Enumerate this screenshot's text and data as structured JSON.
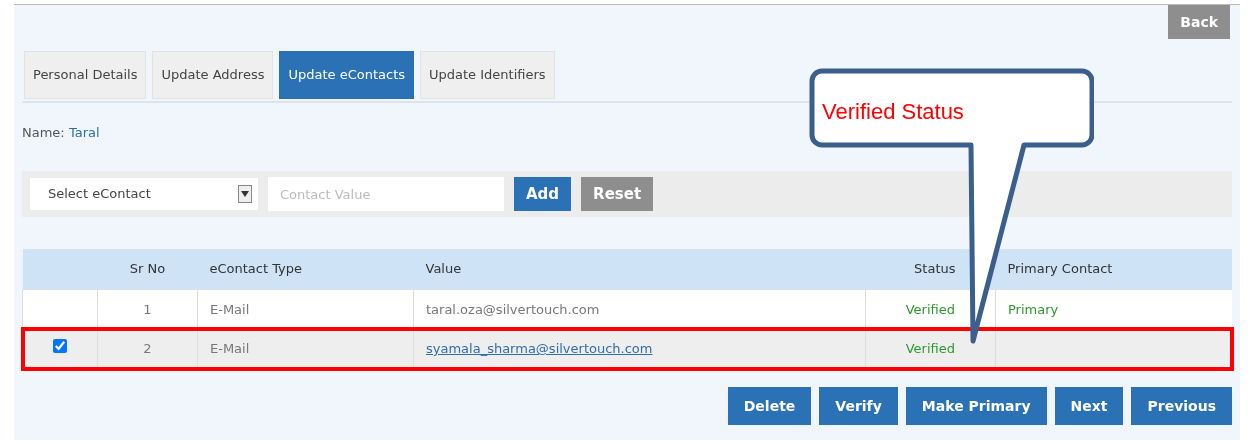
{
  "back_button": "Back",
  "tabs": [
    {
      "label": "Personal Details",
      "selected": false
    },
    {
      "label": "Update Address",
      "selected": false
    },
    {
      "label": "Update eContacts",
      "selected": true
    },
    {
      "label": "Update Identifiers",
      "selected": false
    }
  ],
  "name": {
    "label": "Name:",
    "value": "Taral"
  },
  "form": {
    "select": "Select eContact",
    "placeholder": "Contact Value",
    "buttons": [
      {
        "label": "Add",
        "kind": "primary"
      },
      {
        "label": "Reset",
        "kind": "secondary"
      }
    ]
  },
  "table": {
    "columns": [
      "Sr No",
      "eContact Type",
      "Value",
      "Status",
      "Primary Contact"
    ],
    "rows": [
      {
        "checked": false,
        "highlighted": false,
        "sr_no": "1",
        "type": "E-Mail",
        "value": "taral.oza@silvertouch.com",
        "link": false,
        "status": "Verified",
        "primary": "Primary"
      },
      {
        "checked": true,
        "highlighted": true,
        "sr_no": "2",
        "type": "E-Mail",
        "value": "syamala_sharma@silvertouch.com",
        "link": true,
        "status": "Verified"
      }
    ]
  },
  "actions": [
    "Delete",
    "Verify",
    "Make Primary",
    "Next",
    "Previous"
  ],
  "callout": {
    "text": "Verified Status"
  }
}
